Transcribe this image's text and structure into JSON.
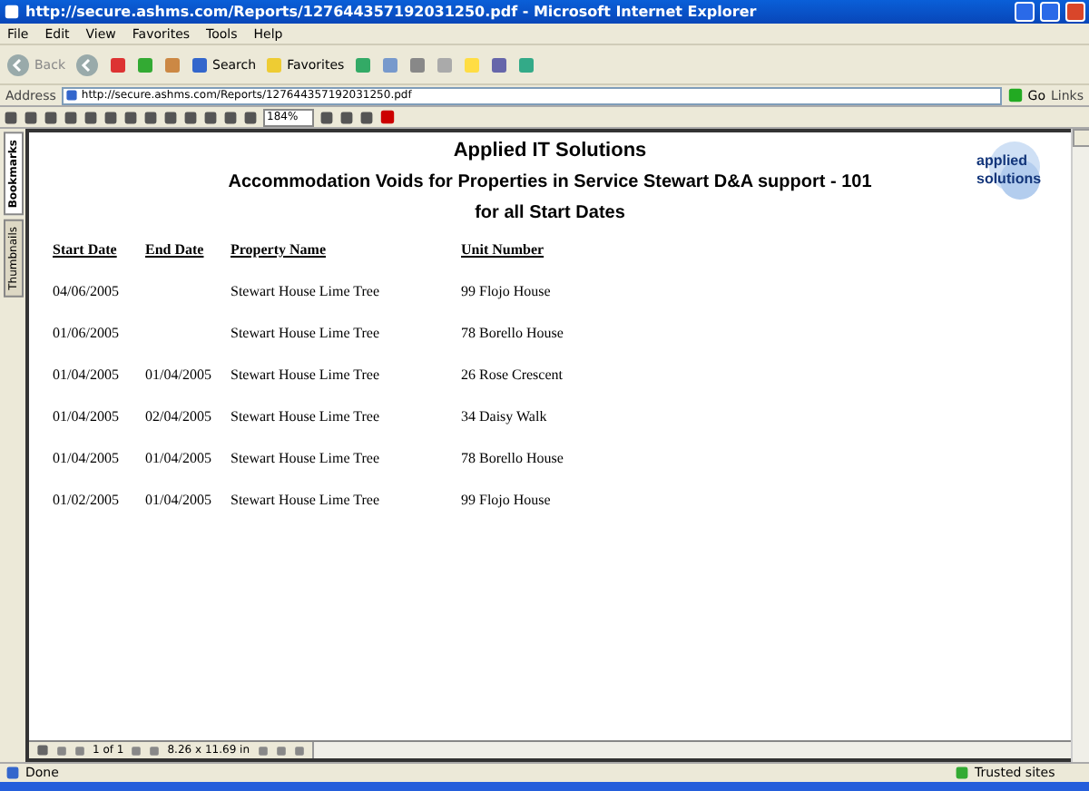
{
  "window": {
    "title": "http://secure.ashms.com/Reports/127644357192031250.pdf - Microsoft Internet Explorer"
  },
  "menu": [
    "File",
    "Edit",
    "View",
    "Favorites",
    "Tools",
    "Help"
  ],
  "toolbar": {
    "back": "Back",
    "search": "Search",
    "favorites": "Favorites"
  },
  "address": {
    "label": "Address",
    "value": "http://secure.ashms.com/Reports/127644357192031250.pdf",
    "go": "Go",
    "links": "Links"
  },
  "pdf_toolbar": {
    "zoom": "184%"
  },
  "side_tabs": [
    {
      "label": "Bookmarks",
      "selected": true
    },
    {
      "label": "Thumbnails",
      "selected": false
    }
  ],
  "report": {
    "company": "Applied IT Solutions",
    "title": "Accommodation Voids for Properties in Service Stewart D&A support - 101",
    "subtitle": "for all Start Dates",
    "logo": [
      "applied",
      "solutions"
    ],
    "columns": [
      "Start Date",
      "End Date",
      "Property Name",
      "Unit Number"
    ],
    "rows": [
      [
        "04/06/2005",
        "",
        "Stewart House Lime Tree",
        "99 Flojo House"
      ],
      [
        "01/06/2005",
        "",
        "Stewart House Lime Tree",
        "78 Borello House"
      ],
      [
        "01/04/2005",
        "01/04/2005",
        "Stewart House Lime Tree",
        "26 Rose Crescent"
      ],
      [
        "01/04/2005",
        "02/04/2005",
        "Stewart House Lime Tree",
        "34 Daisy Walk"
      ],
      [
        "01/04/2005",
        "01/04/2005",
        "Stewart House Lime Tree",
        "78 Borello House"
      ],
      [
        "01/02/2005",
        "01/04/2005",
        "Stewart House Lime Tree",
        "99 Flojo House"
      ]
    ]
  },
  "page_nav": {
    "page": "1 of 1",
    "size": "8.26 x 11.69 in"
  },
  "status_bar": {
    "text": "Done",
    "zone": "Trusted sites"
  }
}
